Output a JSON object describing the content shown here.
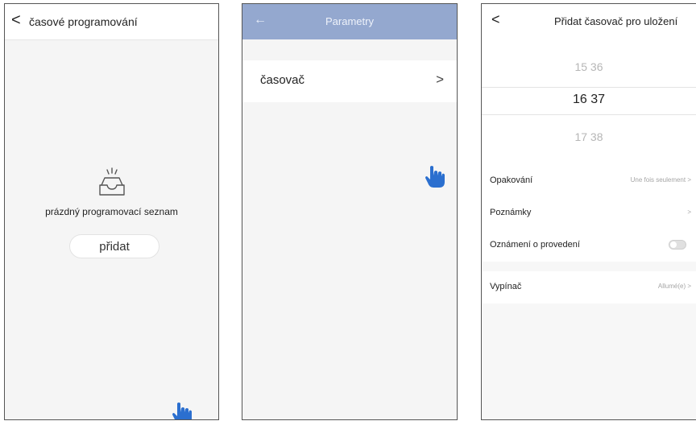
{
  "screen1": {
    "title": "časové programování",
    "back_glyph": "<",
    "empty_icon": "empty-inbox-icon",
    "empty_text": "prázdný programovací seznam",
    "add_button": "přidat",
    "pointer_icon": "hand-pointer-icon"
  },
  "screen2": {
    "title": "Parametry",
    "back_glyph": "←",
    "header_color": "#94a8cf",
    "row_label": "časovač",
    "row_chevron": ">",
    "pointer_icon": "hand-pointer-icon"
  },
  "screen3": {
    "title": "Přidat časovač pro uložení",
    "back_glyph": "<",
    "time_picker": {
      "above": "15  36",
      "selected": "16  37",
      "below": "17  38"
    },
    "options": [
      {
        "label": "Opakování",
        "value": "Une fois seulement >"
      },
      {
        "label": "Poznámky",
        "value": ">"
      },
      {
        "label": "Oznámení o provedení",
        "toggle": "off"
      },
      {
        "label": "Vypínač",
        "value": "Allumé(e) >"
      }
    ]
  },
  "colors": {
    "accent_blue": "#2b6fcf",
    "header_blue": "#94a8cf"
  }
}
